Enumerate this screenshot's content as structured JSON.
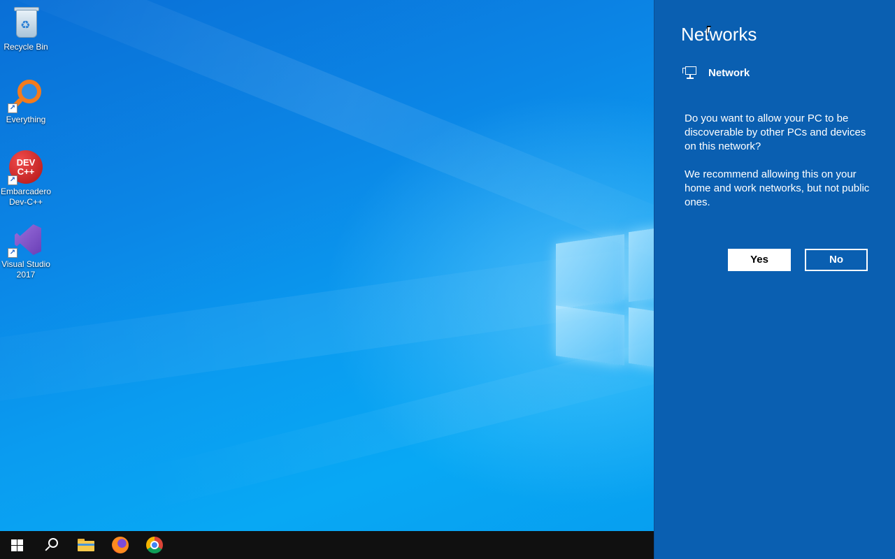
{
  "desktop": {
    "icons": [
      {
        "label": "Recycle Bin",
        "icon": "recycle-bin-icon"
      },
      {
        "label": "Everything",
        "icon": "everything-search-icon"
      },
      {
        "label": "Embarcadero\nDev-C++",
        "line1": "Embarcadero",
        "line2": "Dev-C++",
        "icon": "dev-cpp-icon",
        "art_text_1": "DEV",
        "art_text_2": "C++"
      },
      {
        "label": "Visual Studio 2017",
        "line1": "Visual Studio",
        "line2": "2017",
        "icon": "visual-studio-icon"
      }
    ]
  },
  "taskbar": {
    "items": [
      {
        "name": "start",
        "icon": "windows-start-icon"
      },
      {
        "name": "search",
        "icon": "search-icon"
      },
      {
        "name": "file-explorer",
        "icon": "folder-icon"
      },
      {
        "name": "firefox",
        "icon": "firefox-icon"
      },
      {
        "name": "chrome",
        "icon": "chrome-icon"
      }
    ]
  },
  "networks_flyout": {
    "title": "Networks",
    "network_name": "Network",
    "network_icon": "wired-network-monitor-icon",
    "question": "Do you want to allow your PC to be discoverable by other PCs and devices on this network?",
    "recommendation": "We recommend allowing this on your home and work networks, but not public ones.",
    "yes_label": "Yes",
    "no_label": "No"
  },
  "colors": {
    "flyout_bg": "#0a5fb1",
    "taskbar_bg": "#101010",
    "wallpaper_accent": "#0a9cf0"
  }
}
